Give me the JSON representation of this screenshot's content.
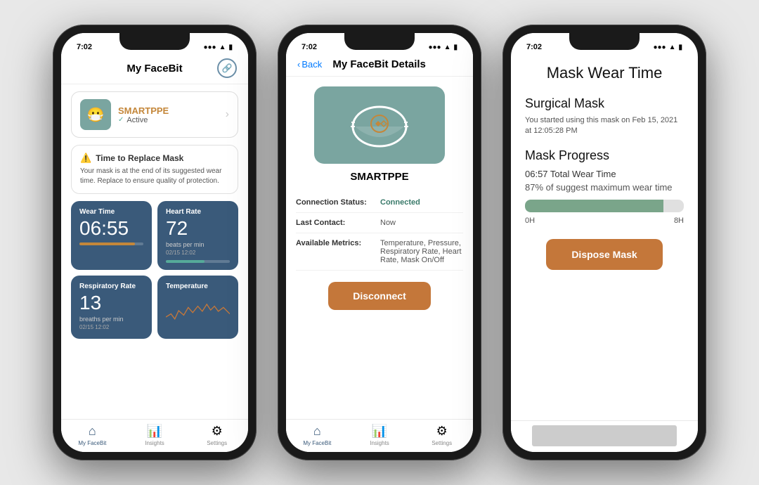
{
  "phone1": {
    "status_time": "7:02",
    "nav_title": "My FaceBit",
    "device": {
      "name": "SMARTPPE",
      "status": "Active"
    },
    "warning": {
      "title": "Time to Replace Mask",
      "text": "Your mask is at the end of its suggested wear time. Replace to ensure quality of protection."
    },
    "metrics": [
      {
        "label": "Wear Time",
        "value": "06:55",
        "bar_pct": 87,
        "bar_color": "orange"
      },
      {
        "label": "Heart Rate",
        "value": "72",
        "unit": "beats per min",
        "date": "02/15 12:02",
        "bar_pct": 60,
        "bar_color": "green"
      },
      {
        "label": "Respiratory Rate",
        "value": "13",
        "unit": "breaths per min",
        "date": "02/15 12:02"
      },
      {
        "label": "Temperature",
        "value": ""
      }
    ],
    "tabs": [
      "My FaceBit",
      "Insights",
      "Settings"
    ]
  },
  "phone2": {
    "status_time": "7:02",
    "nav_back": "Back",
    "nav_title": "My FaceBit Details",
    "device_name": "SMARTPPE",
    "connection_status_label": "Connection Status:",
    "connection_status_value": "Connected",
    "last_contact_label": "Last Contact:",
    "last_contact_value": "Now",
    "available_metrics_label": "Available Metrics:",
    "available_metrics_value": "Temperature, Pressure, Respiratory Rate, Heart Rate, Mask On/Off",
    "disconnect_label": "Disconnect",
    "tabs": [
      "My FaceBit",
      "Insights",
      "Settings"
    ]
  },
  "phone3": {
    "status_time": "7:02",
    "screen_title": "Mask Wear Time",
    "section_mask": "Surgical Mask",
    "mask_subtitle": "You started using this mask on Feb 15, 2021 at 12:05:28 PM",
    "section_progress": "Mask Progress",
    "total_wear_time": "06:57 Total Wear Time",
    "pct_label": "87% of suggest maximum wear time",
    "progress_pct": 87,
    "progress_start": "0H",
    "progress_end": "8H",
    "dispose_label": "Dispose Mask"
  },
  "icons": {
    "mask": "😷",
    "home": "⌂",
    "chart": "📊",
    "gear": "⚙",
    "warning": "⚠️",
    "link": "🔗",
    "chevron": "›",
    "back_chevron": "‹"
  }
}
